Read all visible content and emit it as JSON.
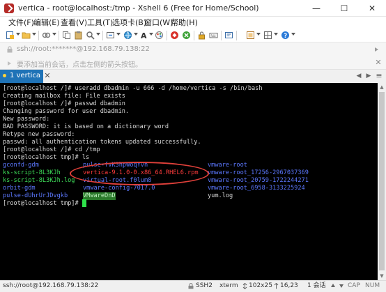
{
  "window": {
    "title": "vertica - root@localhost:/tmp - Xshell 6 (Free for Home/School)",
    "minimize_glyph": "—",
    "maximize_glyph": "☐",
    "close_glyph": "✕"
  },
  "menu": [
    "文件(F)",
    "编辑(E)",
    "查看(V)",
    "工具(T)",
    "选项卡(B)",
    "窗口(W)",
    "帮助(H)"
  ],
  "address": {
    "text": "ssh://root:*******@192.168.79.138:22"
  },
  "hint": {
    "text": "要添加当前会话，点击左侧的箭头按钮。",
    "close_glyph": "✕"
  },
  "tabs": [
    {
      "label": "1 vertica",
      "close_glyph": "✕"
    }
  ],
  "tab_nav": {
    "prev": "◀",
    "next": "▶",
    "menu": "≡"
  },
  "terminal": {
    "lines": [
      "[root@localhost /]# useradd dbadmin -u 666 -d /home/vertica -s /bin/bash",
      "Creating mailbox file: File exists",
      "[root@localhost /]# passwd dbadmin",
      "Changing password for user dbadmin.",
      "New password:",
      "BAD PASSWORD: it is based on a dictionary word",
      "Retype new password:",
      "passwd: all authentication tokens updated successfully.",
      "[root@localhost /]# cd /tmp",
      "[root@localhost tmp]# ls"
    ],
    "ls_rows": [
      [
        "gconfd-gdm",
        "pulse-fvK3hpWoqYvn",
        "vmware-root"
      ],
      [
        "ks-script-8L3KJh",
        "vertica-9.1.0-0.x86_64.RHEL6.rpm",
        "vmware-root_17256-2967037369"
      ],
      [
        "ks-script-8L3KJh.log",
        "virtual-root.f0lum8",
        "vmware-root_20759-1722244271"
      ],
      [
        "orbit-gdm",
        "vmware-config-7017.0",
        "vmware-root_6958-3133225924"
      ],
      [
        "pulse-dUhrUrJDvgkb",
        "VMwareDnD",
        "yum.log"
      ]
    ],
    "prompt": "[root@localhost tmp]# "
  },
  "scrollbar": {
    "up": "▲",
    "down": "▼"
  },
  "status": {
    "connection": "ssh://root@192.168.79.138:22",
    "protocol": "SSH2",
    "terminal_type": "xterm",
    "size": "102x25",
    "cursor_pos": "16,23",
    "sessions": "1 会话",
    "caps": "CAP",
    "num": "NUM"
  },
  "colors": {
    "accent": "#1f73b7",
    "terminal_bg": "#000000",
    "dir_blue": "#5c78ff",
    "exec_green": "#3ee05a",
    "rpm_red": "#ff3c3c",
    "annotation_red": "#e0403a"
  },
  "icons": {
    "app": "xshell-icon",
    "toolbar": [
      "new-session-icon",
      "open-folder-icon",
      "link-icon",
      "copy-icon",
      "paste-icon",
      "find-icon",
      "reconnect-icon",
      "globe-icon",
      "font-icon",
      "color-scheme-icon",
      "xftp-icon",
      "xmanager-icon",
      "lock-icon",
      "keyboard-icon",
      "compose-icon",
      "fullscreen-icon",
      "layout-icon",
      "help-icon"
    ]
  }
}
